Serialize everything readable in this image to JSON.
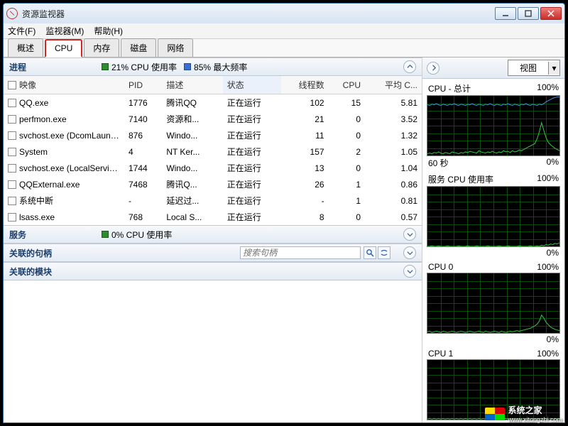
{
  "window": {
    "title": "资源监视器"
  },
  "menu": {
    "file": "文件(F)",
    "monitor": "监视器(M)",
    "help": "帮助(H)"
  },
  "tabs": {
    "overview": "概述",
    "cpu": "CPU",
    "memory": "内存",
    "disk": "磁盘",
    "network": "网络"
  },
  "processes": {
    "title": "进程",
    "cpu_usage": "21% CPU 使用率",
    "max_freq": "85% 最大频率",
    "columns": {
      "image": "映像",
      "pid": "PID",
      "desc": "描述",
      "status": "状态",
      "threads": "线程数",
      "cpu": "CPU",
      "avg": "平均 C..."
    },
    "rows": [
      {
        "image": "QQ.exe",
        "pid": "1776",
        "desc": "腾讯QQ",
        "status": "正在运行",
        "threads": "102",
        "cpu": "15",
        "avg": "5.81"
      },
      {
        "image": "perfmon.exe",
        "pid": "7140",
        "desc": "资源和...",
        "status": "正在运行",
        "threads": "21",
        "cpu": "0",
        "avg": "3.52"
      },
      {
        "image": "svchost.exe (DcomLaunch)",
        "pid": "876",
        "desc": "Windo...",
        "status": "正在运行",
        "threads": "11",
        "cpu": "0",
        "avg": "1.32"
      },
      {
        "image": "System",
        "pid": "4",
        "desc": "NT Ker...",
        "status": "正在运行",
        "threads": "157",
        "cpu": "2",
        "avg": "1.05"
      },
      {
        "image": "svchost.exe (LocalServiceN...",
        "pid": "1744",
        "desc": "Windo...",
        "status": "正在运行",
        "threads": "13",
        "cpu": "0",
        "avg": "1.04"
      },
      {
        "image": "QQExternal.exe",
        "pid": "7468",
        "desc": "腾讯Q...",
        "status": "正在运行",
        "threads": "26",
        "cpu": "1",
        "avg": "0.86"
      },
      {
        "image": "系统中断",
        "pid": "-",
        "desc": "延迟过...",
        "status": "正在运行",
        "threads": "-",
        "cpu": "1",
        "avg": "0.81"
      },
      {
        "image": "lsass.exe",
        "pid": "768",
        "desc": "Local S...",
        "status": "正在运行",
        "threads": "8",
        "cpu": "0",
        "avg": "0.57"
      }
    ]
  },
  "services": {
    "title": "服务",
    "cpu_usage": "0% CPU 使用率"
  },
  "handles": {
    "title": "关联的句柄",
    "search_placeholder": "搜索句柄"
  },
  "modules": {
    "title": "关联的模块"
  },
  "right": {
    "view_label": "视图",
    "graphs": [
      {
        "title": "CPU - 总计",
        "max": "100%",
        "foot_left": "60 秒",
        "foot_right": "0%"
      },
      {
        "title": "服务 CPU 使用率",
        "max": "100%",
        "foot_left": "",
        "foot_right": "0%"
      },
      {
        "title": "CPU 0",
        "max": "100%",
        "foot_left": "",
        "foot_right": "0%"
      },
      {
        "title": "CPU 1",
        "max": "100%",
        "foot_left": "",
        "foot_right": ""
      }
    ]
  },
  "watermark": {
    "text": "系统之家",
    "url": "www.xitongzhi.com"
  },
  "chart_data": [
    {
      "type": "line",
      "title": "CPU - 总计",
      "ylim": [
        0,
        100
      ],
      "xlabel": "60 秒",
      "series": [
        {
          "name": "usage",
          "color": "#2ecc40",
          "values": [
            3,
            4,
            3,
            5,
            4,
            6,
            4,
            3,
            5,
            4,
            3,
            6,
            5,
            4,
            3,
            5,
            4,
            6,
            5,
            7,
            6,
            5,
            4,
            8,
            6,
            5,
            4,
            6,
            5,
            7,
            5,
            4,
            6,
            5,
            8,
            6,
            7,
            5,
            8,
            6,
            7,
            9,
            8,
            10,
            12,
            14,
            16,
            18,
            20,
            28,
            40,
            55,
            42,
            30,
            22,
            18,
            15,
            12,
            10,
            8
          ]
        },
        {
          "name": "max_freq",
          "color": "#3a8ef0",
          "values": [
            85,
            84,
            86,
            85,
            87,
            85,
            84,
            86,
            85,
            84,
            86,
            85,
            87,
            85,
            84,
            86,
            85,
            84,
            86,
            85,
            87,
            85,
            84,
            86,
            85,
            84,
            86,
            85,
            87,
            85,
            84,
            86,
            85,
            84,
            86,
            85,
            87,
            85,
            84,
            86,
            85,
            84,
            86,
            85,
            87,
            85,
            84,
            86,
            85,
            84,
            86,
            85,
            87,
            90,
            92,
            94,
            96,
            97,
            98,
            98
          ]
        }
      ]
    },
    {
      "type": "line",
      "title": "服务 CPU 使用率",
      "ylim": [
        0,
        100
      ],
      "series": [
        {
          "name": "usage",
          "color": "#2ecc40",
          "values": [
            0,
            0,
            1,
            0,
            0,
            1,
            0,
            0,
            0,
            1,
            0,
            0,
            0,
            0,
            1,
            0,
            0,
            0,
            1,
            0,
            0,
            0,
            1,
            0,
            0,
            0,
            0,
            1,
            0,
            0,
            0,
            0,
            1,
            0,
            0,
            0,
            1,
            0,
            0,
            0,
            0,
            1,
            0,
            0,
            0,
            0,
            1,
            0,
            0,
            1,
            0,
            2,
            1,
            3,
            2,
            4,
            3,
            5,
            4,
            6
          ]
        }
      ]
    },
    {
      "type": "line",
      "title": "CPU 0",
      "ylim": [
        0,
        100
      ],
      "series": [
        {
          "name": "usage",
          "color": "#2ecc40",
          "values": [
            2,
            3,
            1,
            2,
            3,
            2,
            1,
            3,
            2,
            1,
            2,
            3,
            2,
            1,
            2,
            3,
            2,
            1,
            2,
            3,
            2,
            1,
            2,
            3,
            2,
            1,
            3,
            2,
            1,
            2,
            3,
            2,
            1,
            3,
            2,
            1,
            2,
            3,
            2,
            3,
            4,
            3,
            4,
            5,
            6,
            7,
            8,
            10,
            12,
            15,
            20,
            30,
            25,
            18,
            14,
            10,
            8,
            6,
            5,
            4
          ]
        }
      ]
    },
    {
      "type": "line",
      "title": "CPU 1",
      "ylim": [
        0,
        100
      ],
      "series": [
        {
          "name": "usage",
          "color": "#2ecc40",
          "values": [
            1,
            2,
            1,
            2,
            1,
            2,
            1,
            2,
            1,
            2,
            1,
            2,
            1,
            2,
            1,
            2,
            1,
            2,
            1,
            2,
            1,
            2,
            1,
            2,
            1,
            2,
            1,
            2,
            1,
            2,
            1,
            2,
            1,
            2,
            1,
            2,
            1,
            2,
            1,
            2,
            1,
            2,
            1,
            2,
            1,
            2,
            1,
            2,
            1,
            2,
            1,
            2,
            1,
            2,
            1,
            2,
            1,
            2,
            1,
            2
          ]
        }
      ]
    }
  ]
}
